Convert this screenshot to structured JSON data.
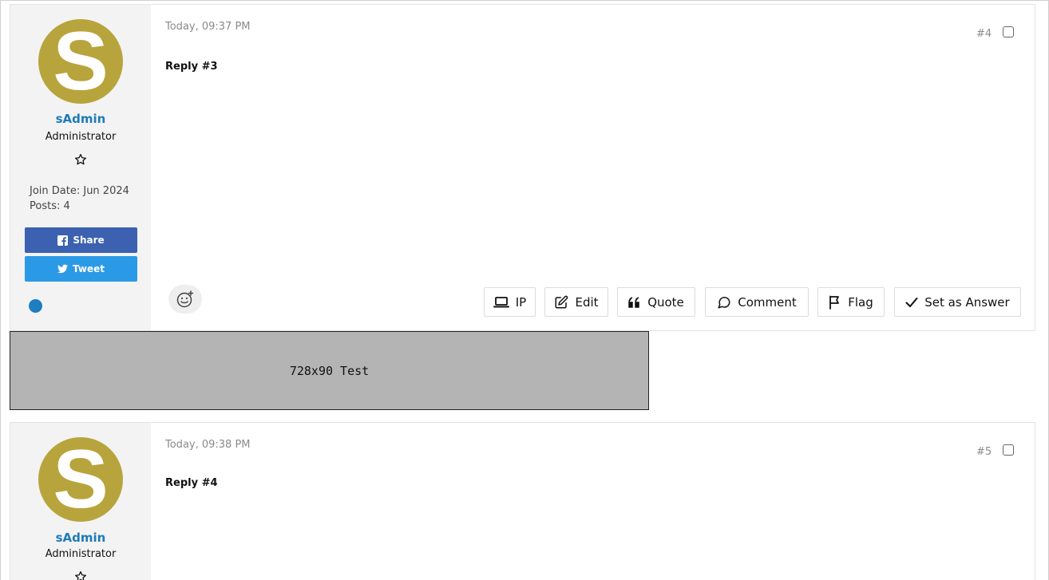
{
  "posts": [
    {
      "timestamp": "Today, 09:37 PM",
      "number": "#4",
      "body": "Reply #3",
      "author": {
        "avatar_letter": "S",
        "username": "sAdmin",
        "role": "Administrator",
        "join_date": "Join Date: Jun 2024",
        "posts": "Posts: 4"
      },
      "share_label": "Share",
      "tweet_label": "Tweet",
      "actions": {
        "ip": "IP",
        "edit": "Edit",
        "quote": "Quote",
        "comment": "Comment",
        "flag": "Flag",
        "answer": "Set as Answer"
      }
    },
    {
      "timestamp": "Today, 09:38 PM",
      "number": "#5",
      "body": "Reply #4",
      "author": {
        "avatar_letter": "S",
        "username": "sAdmin",
        "role": "Administrator"
      }
    }
  ],
  "ad": {
    "label": "728x90 Test"
  },
  "colors": {
    "avatar": "#b8a43c",
    "username": "#1e7bb8",
    "facebook": "#3b61b0",
    "twitter": "#2b9ae6",
    "online": "#1f7ec2"
  },
  "icons": [
    "star-icon",
    "facebook-icon",
    "twitter-icon",
    "emoji-add-icon",
    "laptop-icon",
    "edit-icon",
    "quote-icon",
    "comment-icon",
    "flag-icon",
    "check-icon"
  ]
}
